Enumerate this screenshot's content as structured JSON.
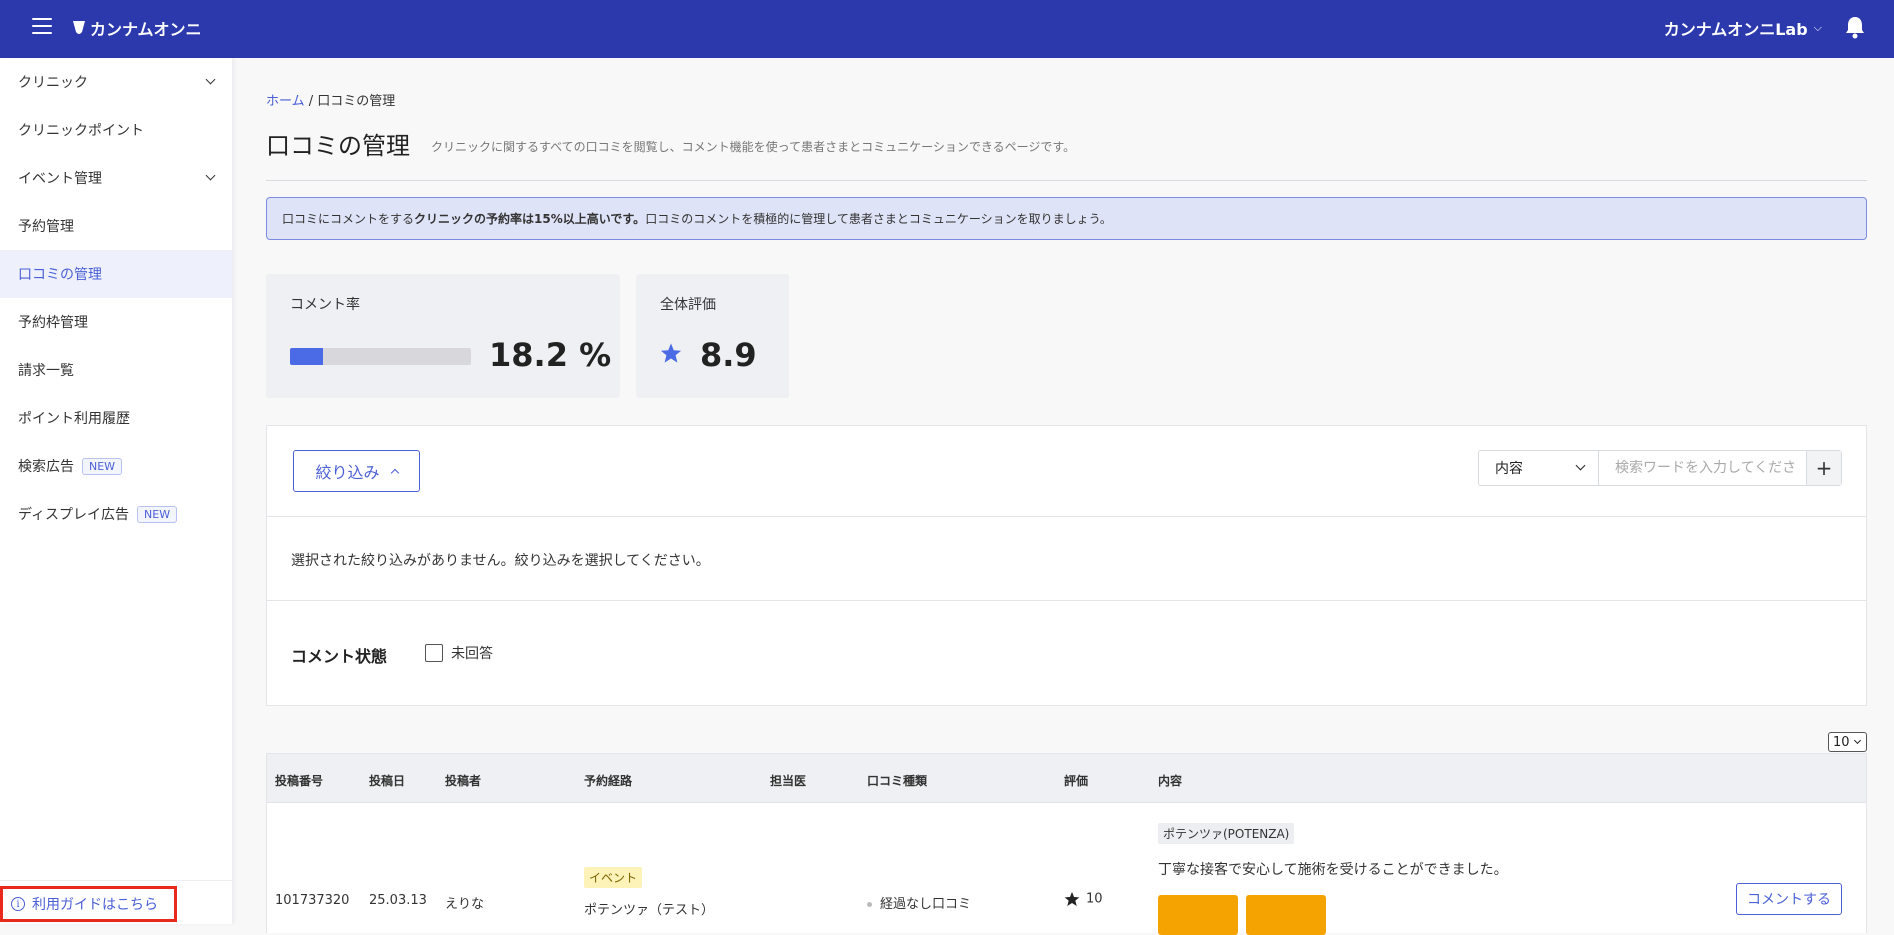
{
  "header": {
    "logo_text": "カンナムオンニ",
    "user_name": "カンナムオンニLab"
  },
  "sidebar": {
    "items": [
      {
        "label": "クリニック"
      },
      {
        "label": "クリニックポイント"
      },
      {
        "label": "イベント管理"
      },
      {
        "label": "予約管理"
      },
      {
        "label": "口コミの管理"
      },
      {
        "label": "予約枠管理"
      },
      {
        "label": "請求一覧"
      },
      {
        "label": "ポイント利用履歴"
      },
      {
        "label": "検索広告",
        "badge": "NEW"
      },
      {
        "label": "ディスプレイ広告",
        "badge": "NEW"
      }
    ],
    "guide_label": "利用ガイドはこちら"
  },
  "breadcrumb": {
    "home": "ホーム",
    "separator": " / ",
    "current": "口コミの管理"
  },
  "page": {
    "title": "口コミの管理",
    "description": "クリニックに関するすべての口コミを閲覧し、コメント機能を使って患者さまとコミュニケーションできるページです。"
  },
  "notice": {
    "prefix": "口コミにコメントをする",
    "bold": "クリニックの予約率は15%以上高いです。",
    "suffix": "口コミのコメントを積極的に管理して患者さまとコミュニケーションを取りましょう。"
  },
  "stats": {
    "comment_rate_label": "コメント率",
    "comment_rate_value": "18.2 %",
    "comment_rate_fraction": 0.182,
    "overall_label": "全体評価",
    "overall_value": "8.9"
  },
  "filter": {
    "button_label": "絞り込み",
    "select_value": "内容",
    "search_placeholder": "検索ワードを入力してくださ",
    "plus_label": "+",
    "no_filter_text": "選択された絞り込みがありません。絞り込みを選択してください。",
    "comment_state_label": "コメント状態",
    "unanswered_label": "未回答"
  },
  "table": {
    "per_page": "10",
    "headers": [
      "投稿番号",
      "投稿日",
      "投稿者",
      "予約経路",
      "担当医",
      "口コミ種類",
      "評価",
      "内容"
    ],
    "rows": [
      {
        "post_no": "101737320",
        "date": "25.03.13",
        "author": "えりな",
        "route_tag": "イベント",
        "route_name": "ポテンツァ（テスト）",
        "doctor": "",
        "review_type": "経過なし口コミ",
        "rating": "10",
        "treatment_tag": "ポテンツァ(POTENZA)",
        "content": "丁寧な接客で安心して施術を受けることができました。",
        "comment_button": "コメントする"
      }
    ]
  },
  "colors": {
    "header_bg": "#2b39ad",
    "accent": "#4b5fd6",
    "progress_fill": "#4b6ae6",
    "thumb": "#f5a300",
    "guide_highlight": "#e8291c"
  }
}
